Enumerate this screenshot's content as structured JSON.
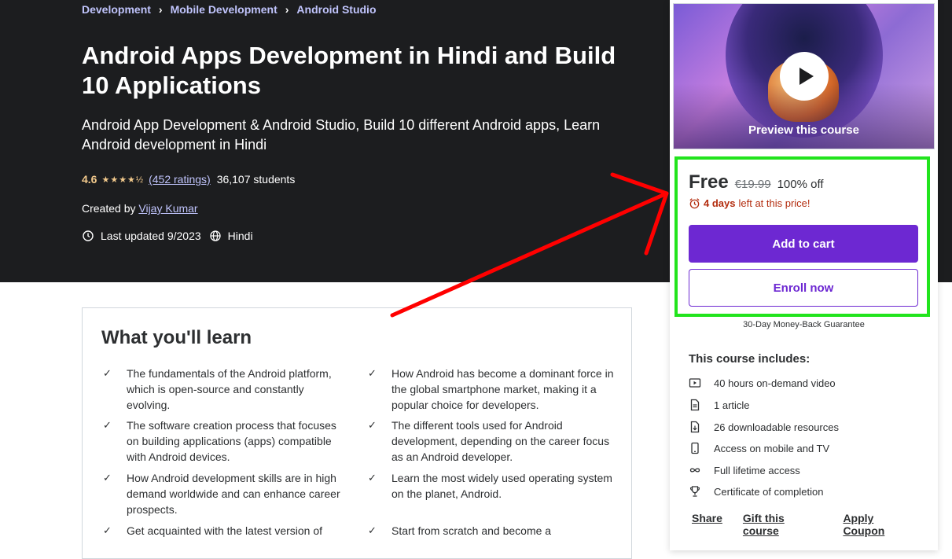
{
  "breadcrumb": [
    "Development",
    "Mobile Development",
    "Android Studio"
  ],
  "breadcrumb_sep": "›",
  "course": {
    "title": "Android Apps Development in Hindi and Build 10 Applications",
    "subtitle": "Android App Development & Android Studio, Build 10 different Android apps, Learn Android development in Hindi",
    "rating": "4.6",
    "rating_value": 4.6,
    "stars": "★★★★½",
    "ratings_count": "(452 ratings)",
    "students": "36,107 students",
    "created_by_label": "Created by",
    "instructor": "Vijay Kumar",
    "last_updated": "Last updated 9/2023",
    "language": "Hindi"
  },
  "learn": {
    "title": "What you'll learn",
    "check": "✓",
    "items": [
      "The fundamentals of the Android platform, which is open-source and constantly evolving.",
      "How Android has become a dominant force in the global smartphone market, making it a popular choice for developers.",
      "The software creation process that focuses on building applications (apps) compatible with Android devices.",
      "The different tools used for Android development, depending on the career focus as an Android developer.",
      "How Android development skills are in high demand worldwide and can enhance career prospects.",
      "Learn the most widely used operating system on the planet, Android.",
      "Get acquainted with the latest version of",
      "Start from scratch and become a"
    ]
  },
  "sidebar": {
    "preview_label": "Preview this course",
    "price_now": "Free",
    "price_old": "€19.99",
    "price_off": "100% off",
    "timer_days": "4 days",
    "timer_rest": "left at this price!",
    "add_to_cart": "Add to cart",
    "enroll_now": "Enroll now",
    "guarantee": "30-Day Money-Back Guarantee",
    "includes_title": "This course includes:",
    "includes": [
      {
        "icon": "video-icon",
        "label": "40 hours on-demand video"
      },
      {
        "icon": "article-icon",
        "label": "1 article"
      },
      {
        "icon": "download-icon",
        "label": "26 downloadable resources"
      },
      {
        "icon": "mobile-icon",
        "label": "Access on mobile and TV"
      },
      {
        "icon": "infinity-icon",
        "label": "Full lifetime access"
      },
      {
        "icon": "trophy-icon",
        "label": "Certificate of completion"
      }
    ],
    "links": [
      "Share",
      "Gift this course",
      "Apply Coupon"
    ]
  },
  "colors": {
    "hero_bg": "#1c1d1f",
    "accent": "#6d28d2",
    "star": "#f3ca8c",
    "link": "#c0c4fc",
    "timer": "#b32d0f",
    "highlight": "#22e41d",
    "annotation_arrow": "#ff0000"
  }
}
